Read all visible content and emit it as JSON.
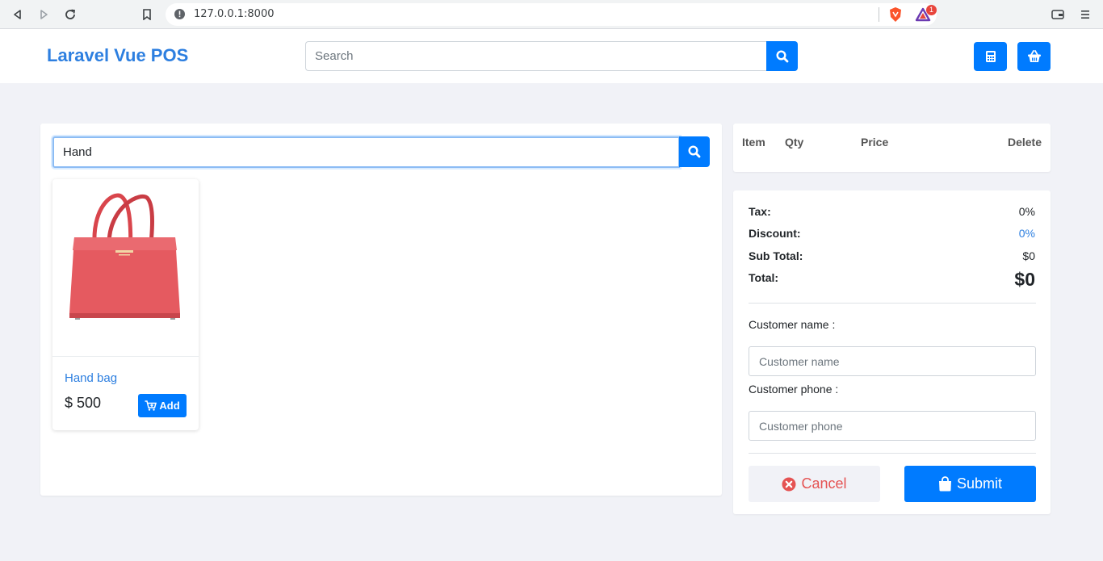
{
  "browser": {
    "url": "127.0.0.1:8000",
    "notification_count": "1"
  },
  "header": {
    "brand": "Laravel Vue POS",
    "search_placeholder": "Search"
  },
  "products": {
    "search_value": "Hand",
    "items": [
      {
        "name": "Hand bag",
        "price": "$ 500",
        "add_label": "Add"
      }
    ]
  },
  "cart": {
    "columns": [
      "Item",
      "Qty",
      "Price",
      "Delete"
    ]
  },
  "summary": {
    "tax_label": "Tax:",
    "tax_value": "0%",
    "discount_label": "Discount:",
    "discount_value": "0%",
    "subtotal_label": "Sub Total:",
    "subtotal_value": "$0",
    "total_label": "Total:",
    "total_value": "$0",
    "discount_color": "#2d7fe0"
  },
  "customer": {
    "name_label": "Customer name :",
    "name_placeholder": "Customer name",
    "phone_label": "Customer phone :",
    "phone_placeholder": "Customer phone"
  },
  "actions": {
    "cancel_label": "Cancel",
    "submit_label": "Submit"
  },
  "colors": {
    "primary": "#007bff",
    "brand": "#2d7fe0",
    "danger": "#e55353",
    "background": "#f1f2f7"
  }
}
